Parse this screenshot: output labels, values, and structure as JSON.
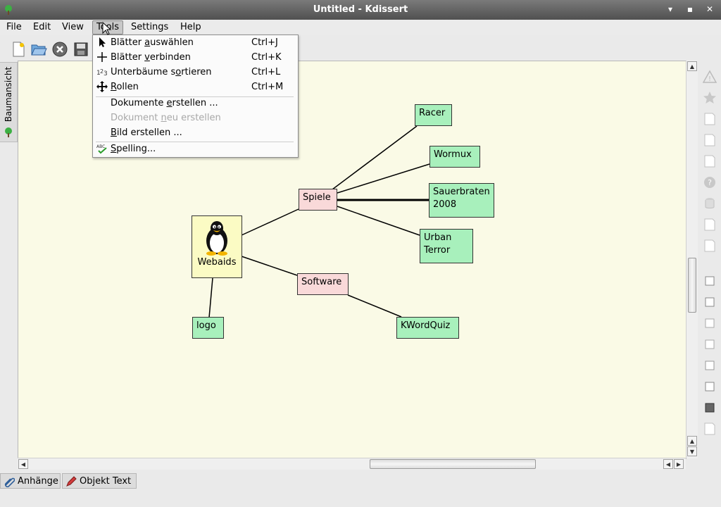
{
  "window": {
    "title": "Untitled - Kdissert",
    "controls": [
      "▾",
      "▪",
      "✕"
    ]
  },
  "menubar": {
    "file": "File",
    "edit": "Edit",
    "view": "View",
    "tools": "Tools",
    "settings": "Settings",
    "help": "Help"
  },
  "toolbar": {
    "icons": [
      "new-document-icon",
      "open-folder-icon",
      "close-icon",
      "save-icon"
    ]
  },
  "left_dock": {
    "tab_label": "Baumansicht"
  },
  "tools_menu": {
    "items": [
      {
        "pre": "Blätter ",
        "u": "a",
        "post": "uswählen",
        "shortcut": "Ctrl+J",
        "icon": "pointer-icon"
      },
      {
        "pre": "Blätter ",
        "u": "v",
        "post": "erbinden",
        "shortcut": "Ctrl+K",
        "icon": "crosshair-icon"
      },
      {
        "pre": "Unterbäume s",
        "u": "o",
        "post": "rtieren",
        "shortcut": "Ctrl+L",
        "icon": "sort-numbers-icon"
      },
      {
        "pre": "",
        "u": "R",
        "post": "ollen",
        "shortcut": "Ctrl+M",
        "icon": "move-arrows-icon"
      },
      {
        "pre": "Dokumente ",
        "u": "e",
        "post": "rstellen ...",
        "shortcut": "",
        "icon": ""
      },
      {
        "pre": "Dokument ",
        "u": "n",
        "post": "eu erstellen",
        "shortcut": "",
        "icon": ""
      },
      {
        "pre": "",
        "u": "B",
        "post": "ild erstellen ...",
        "shortcut": "",
        "icon": ""
      },
      {
        "pre": "",
        "u": "S",
        "post": "pelling...",
        "shortcut": "",
        "icon": "spellcheck-icon"
      }
    ]
  },
  "mindmap": {
    "root": {
      "label": "Webaids",
      "icon": "tux-penguin-icon"
    },
    "branches": [
      {
        "label": "Spiele"
      },
      {
        "label": "Software"
      }
    ],
    "leaves": [
      {
        "line1": "Racer",
        "line2": ""
      },
      {
        "line1": "Wormux",
        "line2": ""
      },
      {
        "line1": "Sauerbraten",
        "line2": "2008"
      },
      {
        "line1": "Urban",
        "line2": "Terror"
      },
      {
        "line1": "KWordQuiz",
        "line2": ""
      },
      {
        "line1": "logo",
        "line2": ""
      }
    ]
  },
  "bottom_tabs": {
    "attachments": "Anhänge",
    "object_text": "Objekt Text"
  },
  "colors": {
    "canvas_bg": "#fafae6",
    "leaf_bg": "#a8f0bc",
    "branch_bg": "#f9d9d9",
    "root_bg": "#fbfbc4",
    "titlebar": "#5a5a5a"
  }
}
